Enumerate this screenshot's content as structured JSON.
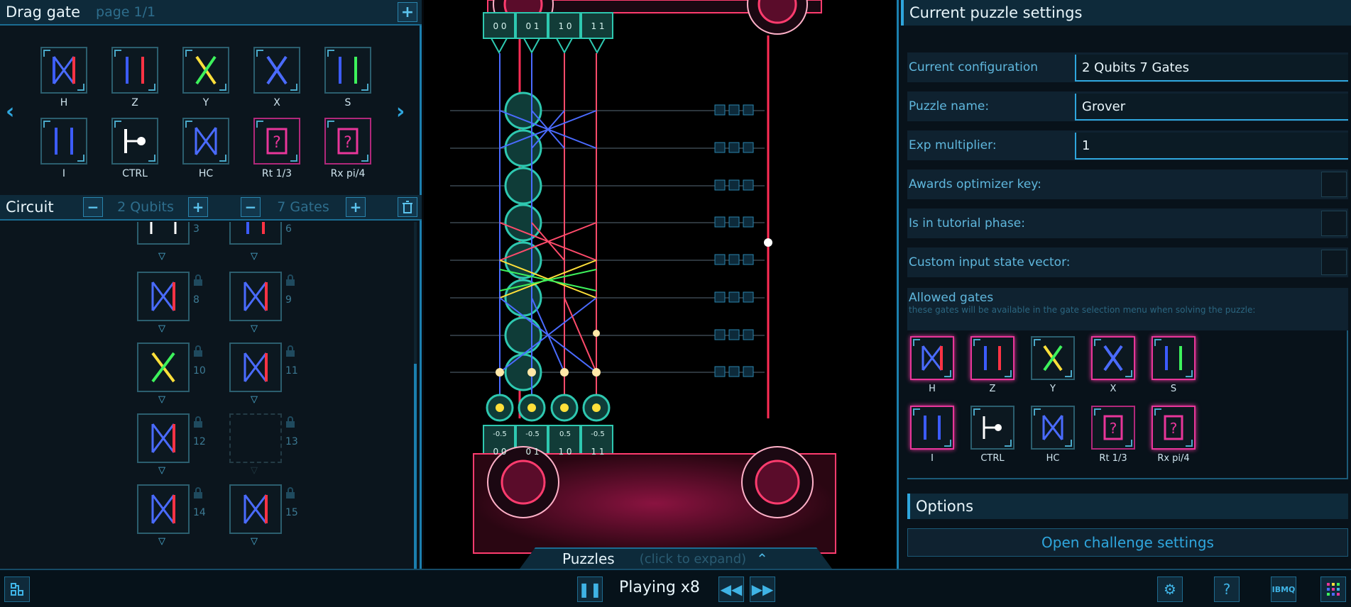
{
  "colors": {
    "accent": "#2fa6dd",
    "pink": "#e8369a",
    "teal": "#2ec8b0",
    "red": "#ff3344"
  },
  "drag_gate": {
    "title": "Drag gate",
    "page": "page 1/1",
    "add_icon": "plus-icon",
    "gates": [
      {
        "label": "H",
        "icon": "gate-h-icon"
      },
      {
        "label": "Z",
        "icon": "gate-z-icon"
      },
      {
        "label": "Y",
        "icon": "gate-y-icon"
      },
      {
        "label": "X",
        "icon": "gate-x-icon"
      },
      {
        "label": "S",
        "icon": "gate-s-icon"
      },
      {
        "label": "I",
        "icon": "gate-i-icon"
      },
      {
        "label": "CTRL",
        "icon": "gate-ctrl-icon"
      },
      {
        "label": "HC",
        "icon": "gate-hc-icon"
      },
      {
        "label": "Rt 1/3",
        "icon": "gate-rt-icon"
      },
      {
        "label": "Rx pi/4",
        "icon": "gate-rx-icon"
      }
    ]
  },
  "circuit": {
    "title": "Circuit",
    "qubits": "2 Qubits",
    "gates": "7 Gates",
    "slot_numbers": [
      "3",
      "6",
      "8",
      "9",
      "10",
      "11",
      "12",
      "13",
      "14",
      "15"
    ]
  },
  "board": {
    "top_states": [
      "0 0",
      "0 1",
      "1 0",
      "1 1"
    ],
    "bottom_values": [
      "-0.5",
      "-0.5",
      "0.5",
      "-0.5"
    ],
    "bottom_states": [
      "0 0",
      "0 1",
      "1 0",
      "1 1"
    ]
  },
  "puzzles_bar": {
    "title": "Puzzles",
    "hint": "(click to expand)"
  },
  "settings": {
    "title": "Current puzzle settings",
    "current_configuration_label": "Current configuration",
    "current_configuration_value": "2 Qubits   7 Gates",
    "puzzle_name_label": "Puzzle name:",
    "puzzle_name_value": "Grover",
    "exp_multiplier_label": "Exp multiplier:",
    "exp_multiplier_value": "1",
    "awards_optimizer_label": "Awards optimizer key:",
    "tutorial_phase_label": "Is in tutorial phase:",
    "custom_input_label": "Custom input state vector:",
    "allowed_gates_title": "Allowed gates",
    "allowed_gates_sub": "these gates will be available in the gate selection menu when solving the puzzle:",
    "allowed_gates": [
      {
        "label": "H",
        "selected": true
      },
      {
        "label": "Z",
        "selected": true
      },
      {
        "label": "Y",
        "selected": false
      },
      {
        "label": "X",
        "selected": true
      },
      {
        "label": "S",
        "selected": true
      },
      {
        "label": "I",
        "selected": true
      },
      {
        "label": "CTRL",
        "selected": false
      },
      {
        "label": "HC",
        "selected": false
      },
      {
        "label": "Rt 1/3",
        "selected": false
      },
      {
        "label": "Rx pi/4",
        "selected": true
      }
    ],
    "options_title": "Options",
    "challenge_button": "Open challenge settings"
  },
  "bottom_bar": {
    "playing": "Playing x8",
    "ibm_label": "IBMQ"
  }
}
